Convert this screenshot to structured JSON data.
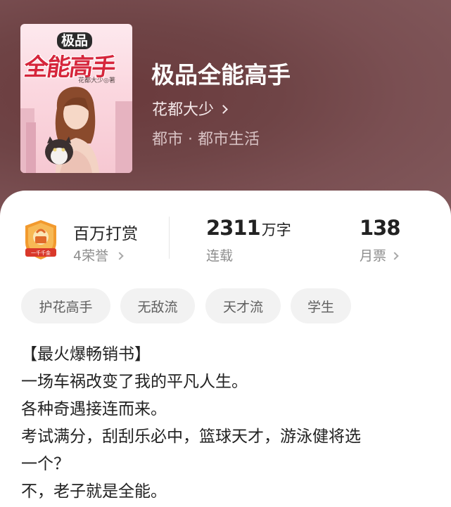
{
  "book": {
    "cover": {
      "top_text": "极品",
      "main_text": "全能高手",
      "author_text": "花都大少◎著"
    },
    "title": "极品全能高手",
    "author": "花都大少",
    "genre": "都市 · 都市生活"
  },
  "stats": {
    "honor": {
      "label": "百万打赏",
      "sub": "4荣誉",
      "badge_text": "一千千金"
    },
    "words": {
      "value": "2311",
      "unit": "万字",
      "sub": "连载"
    },
    "monthly": {
      "value": "138",
      "sub": "月票"
    }
  },
  "tags": [
    "护花高手",
    "无敌流",
    "天才流",
    "学生"
  ],
  "description": [
    "【最火爆畅销书】",
    "一场车祸改变了我的平凡人生。",
    "各种奇遇接连而来。",
    "考试满分，刮刮乐必中，篮球天才，游泳健将选",
    "一个？",
    "不，老子就是全能。"
  ],
  "colors": {
    "hero_bg": "#6f4446",
    "cover_title": "#d6263c",
    "tag_bg": "#f2f2f2",
    "badge_orange": "#f29a2e"
  }
}
